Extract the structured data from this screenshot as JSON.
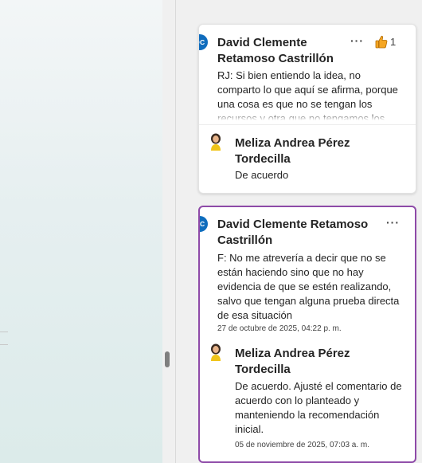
{
  "comments": [
    {
      "avatar": "DC",
      "author": "David Clemente Retamoso Castrillón",
      "text": "RJ: Si bien entiendo la idea, no comparto lo que aquí se afirma, porque una cosa es que no se tengan los recursos y otra que no tengamos los",
      "more_label": "···",
      "like_icon": "thumbs-up-icon",
      "like_count": "1",
      "reply": {
        "author": "Meliza Andrea Pérez Tordecilla",
        "text": "De acuerdo"
      }
    },
    {
      "avatar": "DC",
      "author": "David Clemente Retamoso Castrillón",
      "text": "F: No me atrevería a decir que no se están haciendo sino que no hay evidencia de que se estén realizando, salvo que tengan alguna prueba directa de esa situación",
      "timestamp": "27 de octubre de 2025, 04:22 p. m.",
      "more_label": "···",
      "reply": {
        "author": "Meliza Andrea Pérez Tordecilla",
        "text": "De acuerdo. Ajusté el comentario de acuerdo con lo planteado y manteniendo la recomendación inicial.",
        "timestamp": "05 de noviembre de 2025, 07:03 a. m."
      }
    }
  ],
  "colors": {
    "avatar": "#0f6cbd",
    "active_border": "#8e4aa8",
    "like_yellow": "#f5a623"
  }
}
